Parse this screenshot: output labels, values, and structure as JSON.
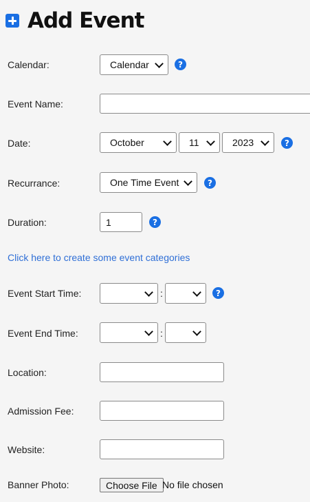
{
  "page": {
    "title": "Add Event"
  },
  "fields": {
    "calendar": {
      "label": "Calendar:",
      "value": "Calendar"
    },
    "event_name": {
      "label": "Event Name:",
      "value": ""
    },
    "date": {
      "label": "Date:",
      "month": "October",
      "day": "11",
      "year": "2023"
    },
    "recurrance": {
      "label": "Recurrance:",
      "value": "One Time Event"
    },
    "duration": {
      "label": "Duration:",
      "value": "1"
    },
    "categories_link": "Click here to create some event categories",
    "start_time": {
      "label": "Event Start Time:",
      "hour": "",
      "minute": "",
      "separator": ":"
    },
    "end_time": {
      "label": "Event End Time:",
      "hour": "",
      "minute": "",
      "separator": ":"
    },
    "location": {
      "label": "Location:",
      "value": ""
    },
    "admission_fee": {
      "label": "Admission Fee:",
      "value": ""
    },
    "website": {
      "label": "Website:",
      "value": ""
    },
    "banner_photo": {
      "label": "Banner Photo:",
      "button": "Choose File",
      "status": "No file chosen"
    }
  },
  "help": {
    "symbol": "?"
  },
  "colors": {
    "accent": "#1a6fe3",
    "link": "#2f6fd6",
    "background": "#f5f5f5"
  }
}
